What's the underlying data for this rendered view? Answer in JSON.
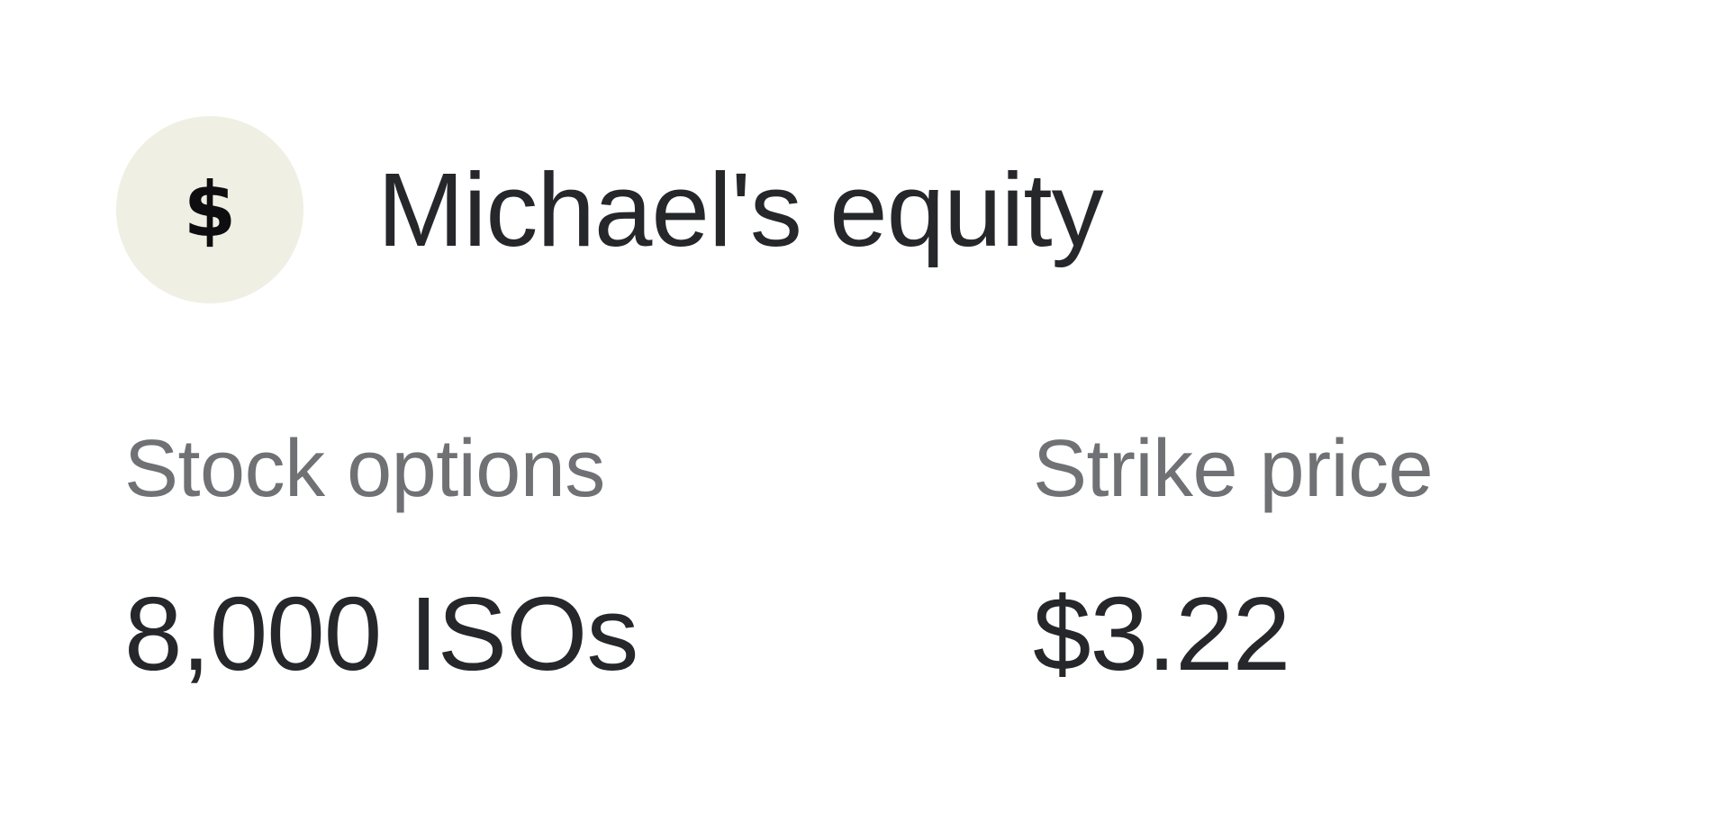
{
  "header": {
    "icon": "dollar-icon",
    "icon_glyph": "$",
    "icon_bg": "#efefe3",
    "title": "Michael's equity"
  },
  "fields": {
    "stock_options": {
      "label": "Stock options",
      "value": "8,000 ISOs"
    },
    "strike_price": {
      "label": "Strike price",
      "value": "$3.22"
    }
  },
  "colors": {
    "text_primary": "#26272b",
    "text_secondary": "#707174"
  }
}
